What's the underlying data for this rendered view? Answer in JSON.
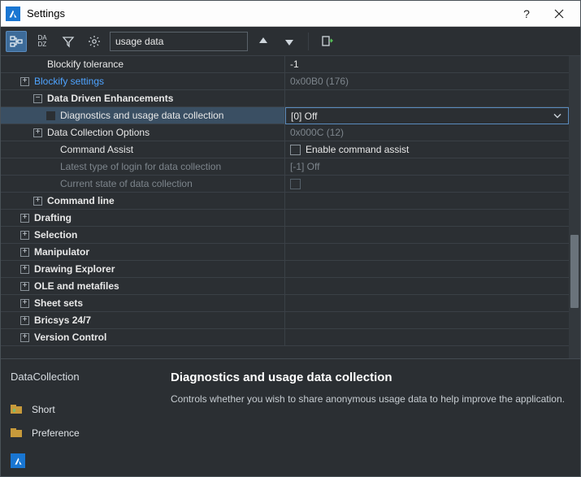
{
  "window": {
    "title": "Settings"
  },
  "toolbar": {
    "search_value": "usage data"
  },
  "rows": [
    {
      "indent": 40,
      "exp": "",
      "label": "Blockify tolerance",
      "value": "-1",
      "bold": false,
      "link": false,
      "dim": false,
      "vdim": false
    },
    {
      "indent": 24,
      "exp": "+",
      "label": "Blockify settings",
      "value": "0x00B0 (176)",
      "bold": false,
      "link": true,
      "dim": false,
      "vdim": true
    },
    {
      "indent": 40,
      "exp": "-",
      "label": "Data Driven Enhancements",
      "value": "",
      "bold": true,
      "link": false,
      "dim": false,
      "vdim": false
    },
    {
      "indent": 56,
      "exp": "",
      "label": "Diagnostics and usage data collection",
      "value": "[0] Off",
      "bold": false,
      "selected": true,
      "dropdown": true
    },
    {
      "indent": 40,
      "exp": "+",
      "label": "Data Collection Options",
      "value": "0x000C (12)",
      "bold": false,
      "dim": false,
      "vdim": true
    },
    {
      "indent": 56,
      "exp": "",
      "label": "Command Assist",
      "value": "Enable command assist",
      "checkbox": true
    },
    {
      "indent": 56,
      "exp": "",
      "label": "Latest type of login for data collection",
      "value": "[-1] Off",
      "dim": true,
      "vdim": true
    },
    {
      "indent": 56,
      "exp": "",
      "label": "Current state of data collection",
      "value": "",
      "dim": true,
      "checkbox": true,
      "cbdim": true
    },
    {
      "indent": 40,
      "exp": "+",
      "label": "Command line",
      "value": "",
      "bold": true
    },
    {
      "indent": 24,
      "exp": "+",
      "label": "Drafting",
      "value": "",
      "bold": true
    },
    {
      "indent": 24,
      "exp": "+",
      "label": "Selection",
      "value": "",
      "bold": true
    },
    {
      "indent": 24,
      "exp": "+",
      "label": "Manipulator",
      "value": "",
      "bold": true
    },
    {
      "indent": 24,
      "exp": "+",
      "label": "Drawing Explorer",
      "value": "",
      "bold": true
    },
    {
      "indent": 24,
      "exp": "+",
      "label": "OLE and metafiles",
      "value": "",
      "bold": true
    },
    {
      "indent": 24,
      "exp": "+",
      "label": "Sheet sets",
      "value": "",
      "bold": true
    },
    {
      "indent": 24,
      "exp": "+",
      "label": "Bricsys 24/7",
      "value": "",
      "bold": true
    },
    {
      "indent": 24,
      "exp": "+",
      "label": "Version Control",
      "value": "",
      "bold": true
    }
  ],
  "detail": {
    "varname": "DataCollection",
    "heading": "Diagnostics and usage data collection",
    "desc": "Controls whether you wish to share anonymous usage data to help improve the application.",
    "suggest_short": "Short",
    "suggest_pref": "Preference"
  }
}
